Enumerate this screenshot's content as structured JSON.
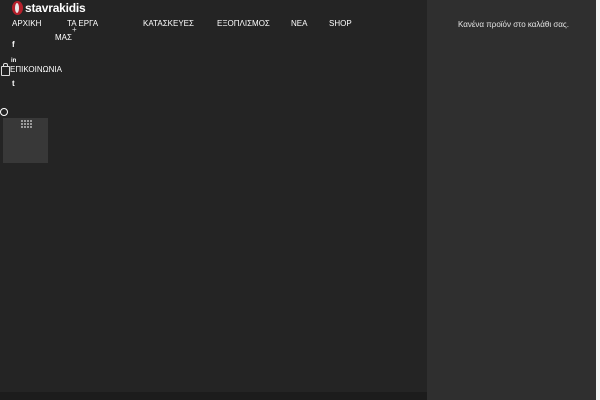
{
  "brand": {
    "logo_text": "stavrakidis"
  },
  "nav": {
    "items": [
      {
        "label": "ΑΡΧΙΚΗ"
      },
      {
        "label": "ΤΑ ΕΡΓΑ"
      },
      {
        "label": "ΜΑΣ"
      },
      {
        "label": "ΚΑΤΑΣΚΕΥΕΣ"
      },
      {
        "label": "ΕΞΟΠΛΙΣΜΟΣ"
      },
      {
        "label": "ΝΕΑ"
      },
      {
        "label": "SHOP"
      },
      {
        "label": "ΕΠΙΚΟΙΝΩΝΙΑ"
      }
    ],
    "submenu_marker": "+"
  },
  "social": {
    "facebook": "f",
    "linkedin": "in",
    "tumblr": "t"
  },
  "cart": {
    "empty_text": "Κανένα προϊόν στο καλάθι σας."
  },
  "colors": {
    "background": "#242424",
    "panel": "#2f2f2f",
    "accent": "#b5202b"
  }
}
